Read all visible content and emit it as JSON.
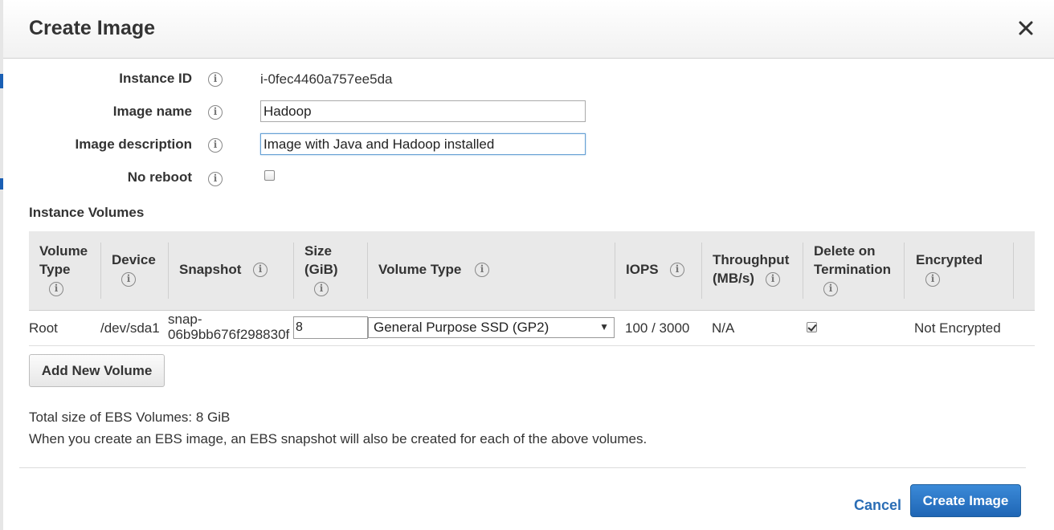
{
  "dialog": {
    "title": "Create Image",
    "close_icon": "close-icon"
  },
  "form": {
    "instance_id": {
      "label": "Instance ID",
      "value": "i-0fec4460a757ee5da"
    },
    "image_name": {
      "label": "Image name",
      "value": "Hadoop"
    },
    "image_description": {
      "label": "Image description",
      "value": "Image with Java and Hadoop installed"
    },
    "no_reboot": {
      "label": "No reboot",
      "checked": false
    }
  },
  "volumes": {
    "section_title": "Instance Volumes",
    "columns": {
      "volume_type_line1": "Volume",
      "volume_type_line2": "Type",
      "device": "Device",
      "snapshot": "Snapshot",
      "size_line1": "Size",
      "size_line2": "(GiB)",
      "volume_type2": "Volume Type",
      "iops": "IOPS",
      "throughput_line1": "Throughput",
      "throughput_line2": "(MB/s)",
      "delete_line1": "Delete on",
      "delete_line2": "Termination",
      "encrypted": "Encrypted"
    },
    "rows": [
      {
        "volume_type": "Root",
        "device": "/dev/sda1",
        "snapshot_line1": "snap-",
        "snapshot_line2": "06b9bb676f298830f",
        "size": "8",
        "ebs_type": "General Purpose SSD (GP2)",
        "iops": "100 / 3000",
        "throughput": "N/A",
        "delete_on_termination": true,
        "encrypted": "Not Encrypted"
      }
    ],
    "add_button": "Add New Volume"
  },
  "footer": {
    "total_size": "Total size of EBS Volumes: 8 GiB",
    "note": "When you create an EBS image, an EBS snapshot will also be created for each of the above volumes."
  },
  "actions": {
    "cancel": "Cancel",
    "submit": "Create Image"
  },
  "colors": {
    "primary": "#2a6db5",
    "header_bg": "#f1f1f1",
    "table_header_bg": "#e9e9e9"
  }
}
